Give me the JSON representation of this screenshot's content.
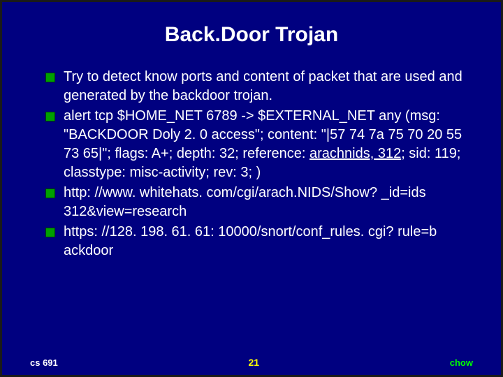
{
  "title": "Back.Door Trojan",
  "bullets": [
    {
      "text": "Try to detect know ports and content of packet  that are used and generated by the backdoor trojan."
    },
    {
      "prefix": "alert tcp $HOME_NET 6789 -> $EXTERNAL_NET any (msg: \"BACKDOOR Doly 2. 0 access\"; content: \"|57 74 7a 75 70 20 55 73 65|\"; flags: A+; depth: 32; reference: ",
      "underlined": "arachnids, 312",
      "suffix": "; sid: 119; classtype: misc-activity; rev: 3; )"
    },
    {
      "text": "http: //www. whitehats. com/cgi/arach.NIDS/Show? _id=ids 312&view=research"
    },
    {
      "text": "https: //128. 198. 61. 61: 10000/snort/conf_rules. cgi? rule=b ackdoor"
    }
  ],
  "footer": {
    "left": "cs 691",
    "center": "21",
    "right": "chow"
  }
}
